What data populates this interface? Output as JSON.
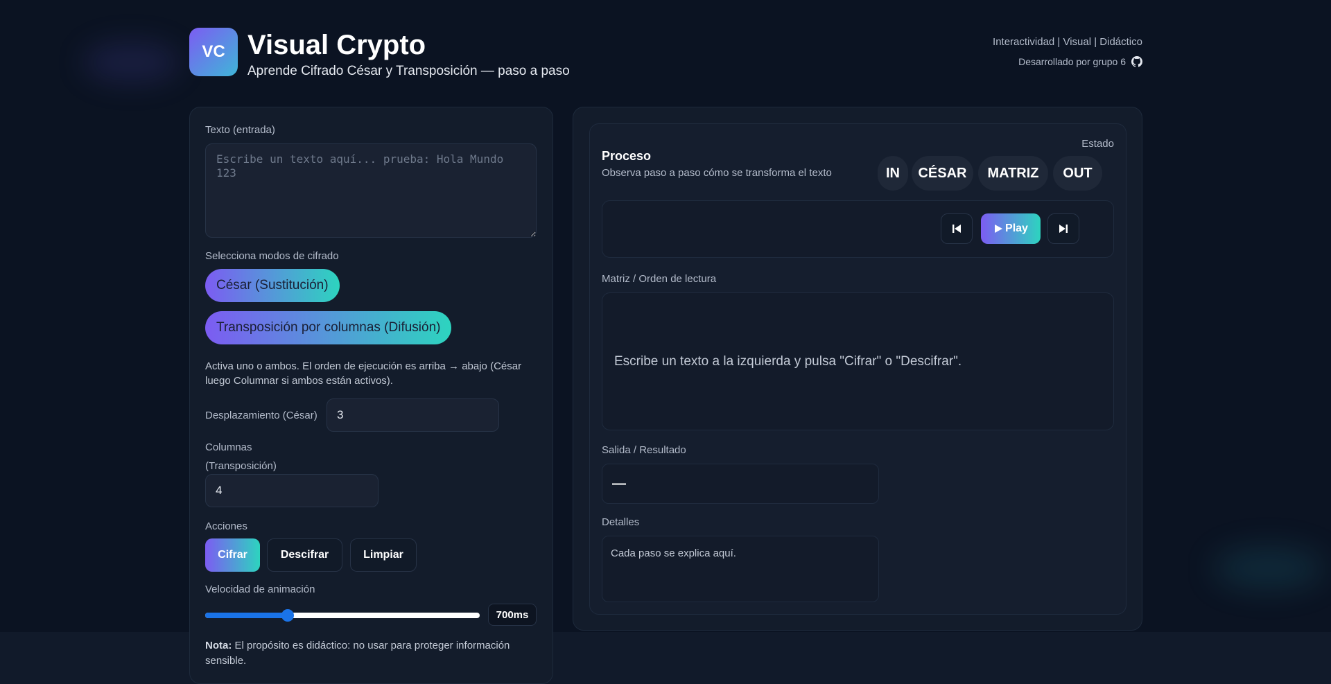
{
  "header": {
    "logo_text": "VC",
    "title": "Visual Crypto",
    "subtitle": "Aprende Cifrado César y Transposición — paso a paso",
    "tags": "Interactividad | Visual | Didáctico",
    "credit": "Desarrollado por grupo 6",
    "credit_icon": "github-icon"
  },
  "input": {
    "label": "Texto (entrada)",
    "placeholder": "Escribe un texto aquí... prueba: Hola Mundo 123",
    "value": ""
  },
  "modes": {
    "label": "Selecciona modos de cifrado",
    "caesar": "César (Sustitución)",
    "transposition": "Transposición por columnas (Difusión)",
    "help": "Activa uno o ambos. El orden de ejecución es arriba → abajo (César luego Columnar si ambos están activos)."
  },
  "shift": {
    "label": "Desplazamiento (César)",
    "value": "3"
  },
  "columns": {
    "label_line1": "Columnas",
    "label_line2": "(Transposición)",
    "value": "4"
  },
  "actions": {
    "label": "Acciones",
    "encrypt": "Cifrar",
    "decrypt": "Descifrar",
    "clear": "Limpiar"
  },
  "speed": {
    "label": "Velocidad de animación",
    "display": "700ms",
    "fraction": 0.3
  },
  "note": {
    "bold": "Nota:",
    "text": " El propósito es didáctico: no usar para proteger información sensible."
  },
  "process": {
    "title": "Proceso",
    "subtitle": "Observa paso a paso cómo se transforma el texto",
    "status_label": "Estado",
    "stages": [
      "IN",
      "CÉSAR",
      "MATRIZ",
      "OUT"
    ],
    "play": "Play"
  },
  "matrix": {
    "label": "Matriz / Orden de lectura",
    "message": "Escribe un texto a la izquierda y pulsa \"Cifrar\" o \"Descifrar\"."
  },
  "output": {
    "label": "Salida / Resultado",
    "value": "—"
  },
  "details": {
    "label": "Detalles",
    "text": "Cada paso se explica aquí."
  },
  "colors": {
    "background": "#0b1322",
    "panel": "#131c2b",
    "accent_start": "#7c5cf2",
    "accent_end": "#2dd4bf",
    "slider": "#1a73e8"
  }
}
